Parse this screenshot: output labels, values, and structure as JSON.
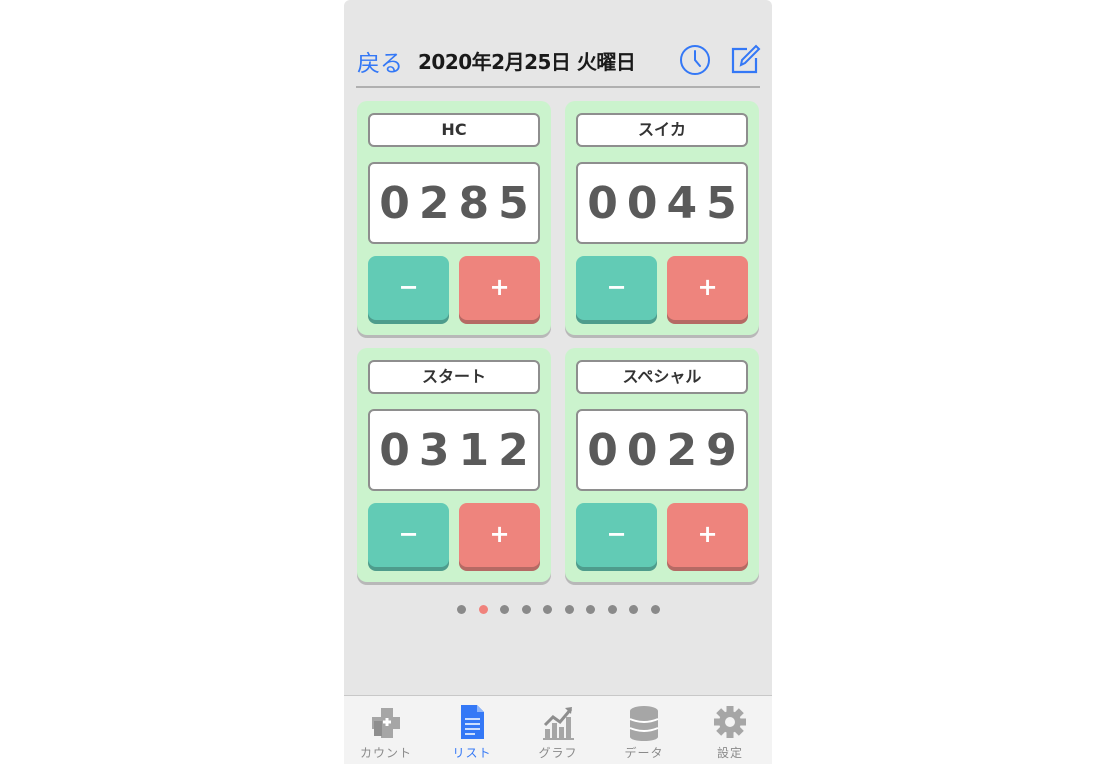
{
  "header": {
    "back_label": "戻る",
    "date_title": "2020年2月25日 火曜日",
    "clock_icon": "clock-icon",
    "compose_icon": "compose-icon",
    "accent_color": "#3478f6"
  },
  "counters": [
    {
      "label": "HC",
      "value": "0285",
      "minus_label": "−",
      "plus_label": "+"
    },
    {
      "label": "スイカ",
      "value": "0045",
      "minus_label": "−",
      "plus_label": "+"
    },
    {
      "label": "スタート",
      "value": "0312",
      "minus_label": "−",
      "plus_label": "+"
    },
    {
      "label": "スペシャル",
      "value": "0029",
      "minus_label": "−",
      "plus_label": "+"
    }
  ],
  "colors": {
    "card_bg": "#cbf3cd",
    "minus_button": "#62cbb5",
    "plus_button": "#ee847d",
    "active_dot": "#f0827c"
  },
  "pager": {
    "page_count": 10,
    "current_page": 2
  },
  "tabbar": {
    "items": [
      {
        "label": "カウント",
        "icon": "plus-box-icon",
        "active": false
      },
      {
        "label": "リスト",
        "icon": "document-icon",
        "active": true
      },
      {
        "label": "グラフ",
        "icon": "chart-icon",
        "active": false
      },
      {
        "label": "データ",
        "icon": "database-icon",
        "active": false
      },
      {
        "label": "設定",
        "icon": "gear-icon",
        "active": false
      }
    ]
  }
}
